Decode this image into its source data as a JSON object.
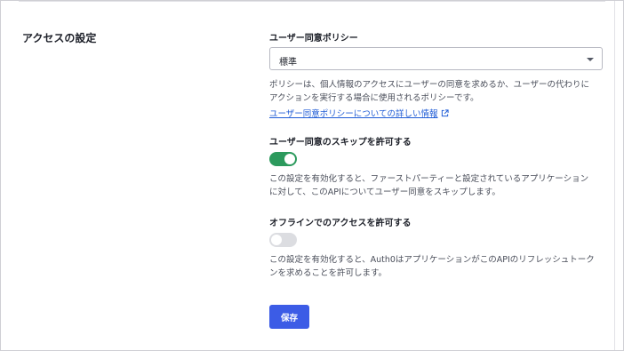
{
  "section": {
    "title": "アクセスの設定"
  },
  "consent_policy": {
    "label": "ユーザー同意ポリシー",
    "selected_value": "標準",
    "help_line1": "ポリシーは、個人情報のアクセスにユーザーの同意を求めるか、ユーザーの代わりに",
    "help_line2": "アクションを実行する場合に使用されるポリシーです。",
    "link_text": "ユーザー同意ポリシーについての詳しい情報"
  },
  "skip_consent": {
    "label": "ユーザー同意のスキップを許可する",
    "enabled": true,
    "help_line1": "この設定を有効化すると、ファーストパーティーと設定されているアプリケーション",
    "help_line2": "に対して、このAPIについてユーザー同意をスキップします。"
  },
  "offline_access": {
    "label": "オフラインでのアクセスを許可する",
    "enabled": false,
    "help_line1": "この設定を有効化すると、Auth0はアプリケーションがこのAPIのリフレッシュトーク",
    "help_line2": "ンを求めることを許可します。"
  },
  "actions": {
    "save_label": "保存"
  },
  "colors": {
    "toggle_on": "#2c9a5d",
    "toggle_off": "#dcdde1",
    "primary_button": "#3c5ce6",
    "link": "#1f5cd6"
  },
  "icons": {
    "select_caret": "chevron-down-icon",
    "link_external": "external-link-icon"
  }
}
